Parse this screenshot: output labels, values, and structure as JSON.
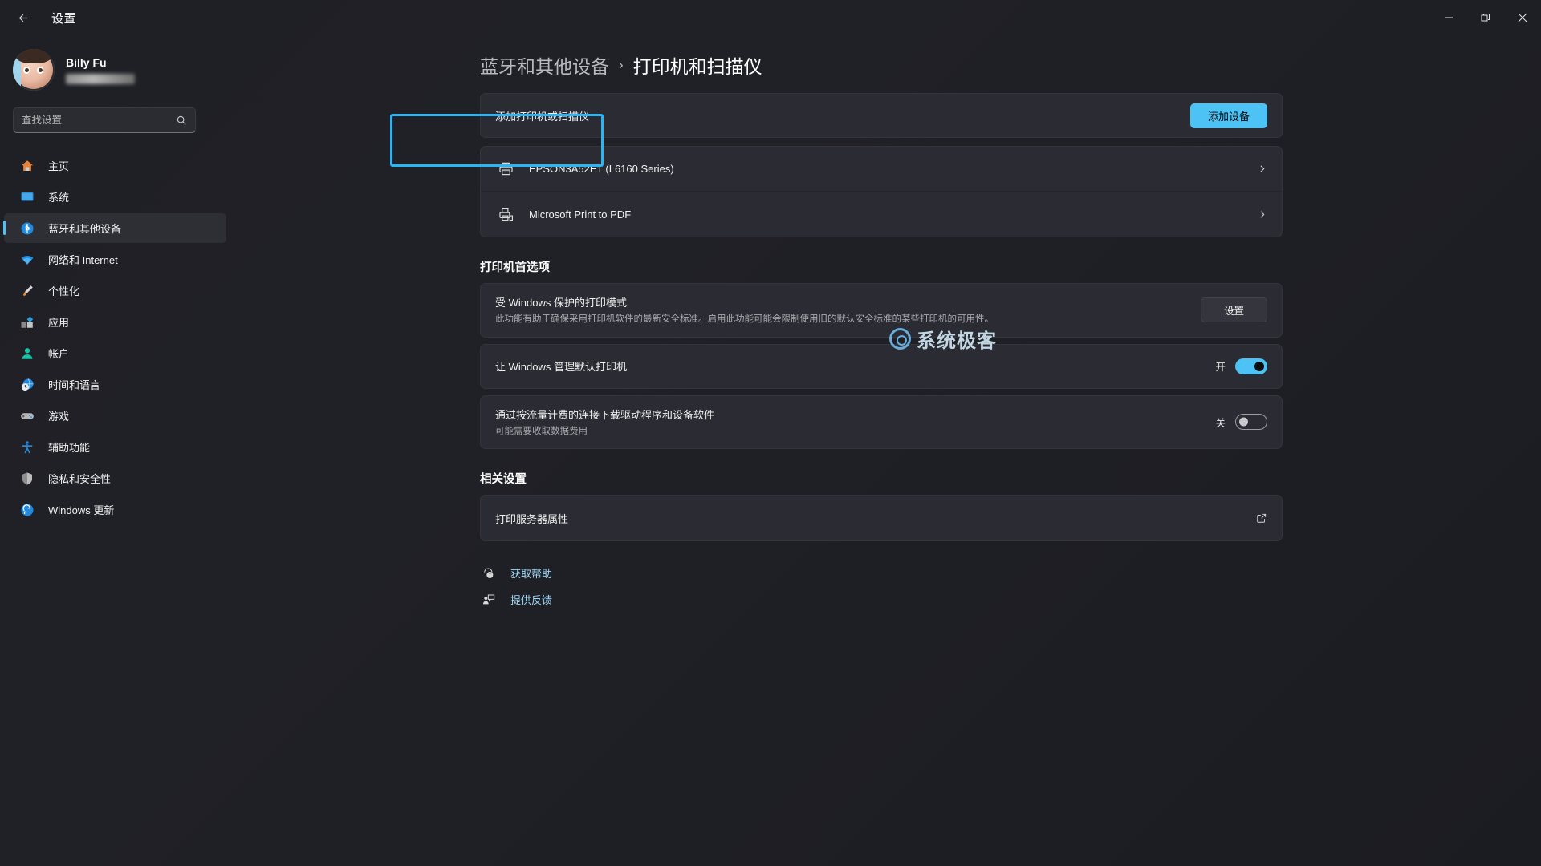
{
  "window": {
    "title": "设置",
    "back_icon": "back-arrow-icon",
    "minimize_label": "—",
    "maximize_label": "❐",
    "close_label": "✕"
  },
  "sidebar": {
    "profile": {
      "name": "Billy Fu",
      "email_redacted": ""
    },
    "search": {
      "placeholder": "查找设置",
      "value": "",
      "icon": "search-icon"
    },
    "items": [
      {
        "label": "主页",
        "icon": "home-icon",
        "active": false
      },
      {
        "label": "系统",
        "icon": "system-icon",
        "active": false
      },
      {
        "label": "蓝牙和其他设备",
        "icon": "bluetooth-icon",
        "active": true
      },
      {
        "label": "网络和 Internet",
        "icon": "network-icon",
        "active": false
      },
      {
        "label": "个性化",
        "icon": "personalization-brush-icon",
        "active": false
      },
      {
        "label": "应用",
        "icon": "apps-icon",
        "active": false
      },
      {
        "label": "帐户",
        "icon": "accounts-person-icon",
        "active": false
      },
      {
        "label": "时间和语言",
        "icon": "time-language-clock-icon",
        "active": false
      },
      {
        "label": "游戏",
        "icon": "gaming-controller-icon",
        "active": false
      },
      {
        "label": "辅助功能",
        "icon": "accessibility-icon",
        "active": false
      },
      {
        "label": "隐私和安全性",
        "icon": "privacy-shield-icon",
        "active": false
      },
      {
        "label": "Windows 更新",
        "icon": "windows-update-icon",
        "active": false
      }
    ]
  },
  "main": {
    "breadcrumb": {
      "parent": "蓝牙和其他设备",
      "separator": "›",
      "current": "打印机和扫描仪"
    },
    "add_printer": {
      "label": "添加打印机或扫描仪",
      "button": "添加设备"
    },
    "printers": [
      {
        "name": "EPSON3A52E1 (L6160 Series)",
        "icon": "printer-icon",
        "highlighted": true
      },
      {
        "name": "Microsoft Print to PDF",
        "icon": "print-to-pdf-icon",
        "highlighted": false
      }
    ],
    "preferences_title": "打印机首选项",
    "preferences": [
      {
        "title": "受 Windows 保护的打印模式",
        "desc": "此功能有助于确保采用打印机软件的最新安全标准。启用此功能可能会限制使用旧的默认安全标准的某些打印机的可用性。",
        "control": "button",
        "button_label": "设置"
      },
      {
        "title": "让 Windows 管理默认打印机",
        "desc": "",
        "control": "toggle",
        "state_label": "开",
        "state_on": true
      },
      {
        "title": "通过按流量计费的连接下载驱动程序和设备软件",
        "desc": "可能需要收取数据费用",
        "control": "toggle",
        "state_label": "关",
        "state_on": false
      }
    ],
    "related_title": "相关设置",
    "related": [
      {
        "label": "打印服务器属性",
        "icon": "external-link-icon"
      }
    ],
    "help_links": [
      {
        "label": "获取帮助",
        "icon": "get-help-icon"
      },
      {
        "label": "提供反馈",
        "icon": "give-feedback-icon"
      }
    ]
  },
  "watermark": {
    "text": "系统极客"
  },
  "colors": {
    "accent": "#4cc2f5",
    "highlight": "#29b6f6",
    "link": "#9fd8f5"
  }
}
